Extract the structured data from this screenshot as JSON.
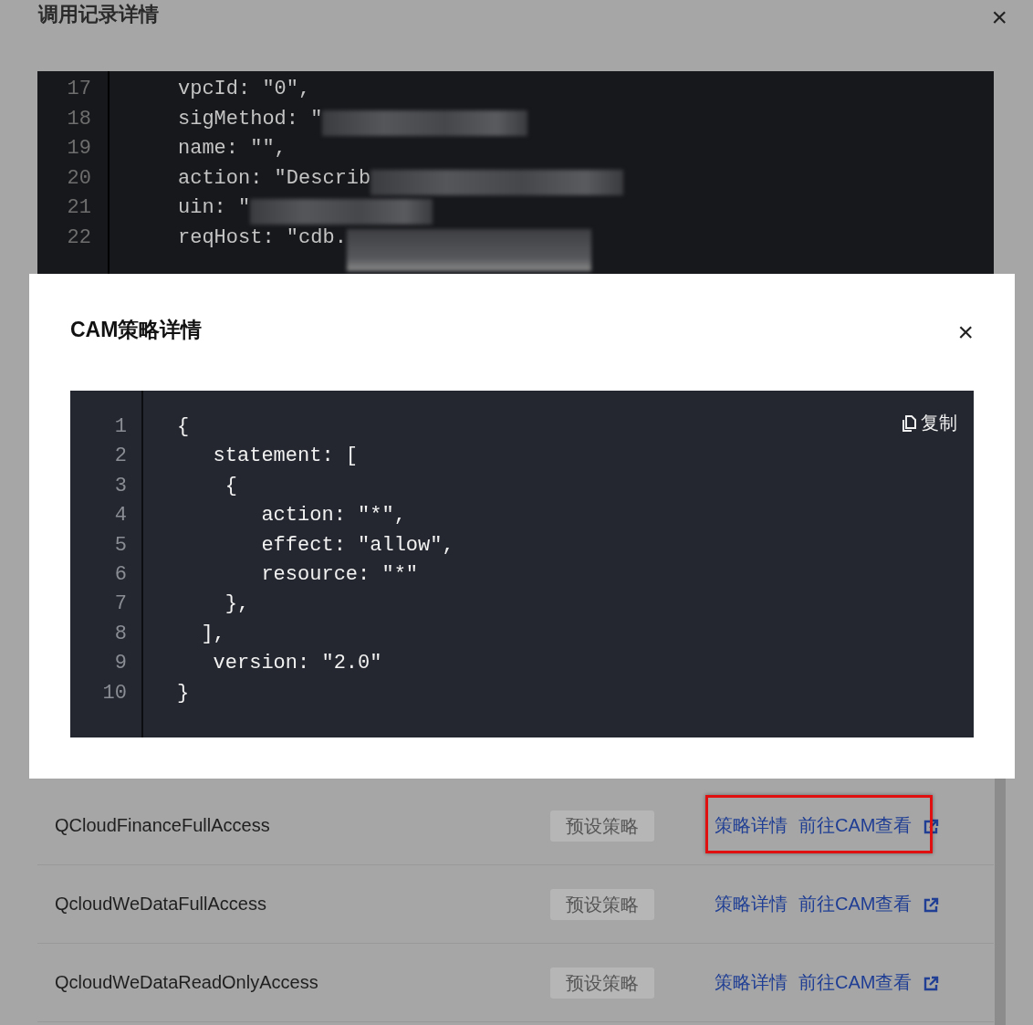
{
  "background_dialog": {
    "title": "调用记录详情",
    "close": "×",
    "code_lines": [
      {
        "number": "17",
        "text": "vpcId: \"0\",",
        "redacted": false
      },
      {
        "number": "18",
        "text": "sigMethod: \"",
        "redacted": true
      },
      {
        "number": "19",
        "text": "name: \"\",",
        "redacted": false
      },
      {
        "number": "20",
        "text": "action: \"Describ",
        "redacted": true
      },
      {
        "number": "21",
        "text": "uin: \"",
        "redacted": true
      },
      {
        "number": "22",
        "text": "reqHost: \"cdb.",
        "redacted": true
      }
    ]
  },
  "policies": [
    {
      "name": "QCloudFinanceFullAccess",
      "tag": "预设策略",
      "detail_link": "策略详情",
      "cam_link": "前往CAM查看",
      "highlighted": true
    },
    {
      "name": "QcloudWeDataFullAccess",
      "tag": "预设策略",
      "detail_link": "策略详情",
      "cam_link": "前往CAM查看",
      "highlighted": false
    },
    {
      "name": "QcloudWeDataReadOnlyAccess",
      "tag": "预设策略",
      "detail_link": "策略详情",
      "cam_link": "前往CAM查看",
      "highlighted": false
    }
  ],
  "modal": {
    "title": "CAM策略详情",
    "close": "×",
    "copy_button": "复制",
    "code_lines": [
      {
        "number": "1",
        "text": "{"
      },
      {
        "number": "2",
        "text": "   statement: ["
      },
      {
        "number": "3",
        "text": "    {"
      },
      {
        "number": "4",
        "text": "       action: \"*\","
      },
      {
        "number": "5",
        "text": "       effect: \"allow\","
      },
      {
        "number": "6",
        "text": "       resource: \"*\""
      },
      {
        "number": "7",
        "text": "    },"
      },
      {
        "number": "8",
        "text": "  ],"
      },
      {
        "number": "9",
        "text": "   version: \"2.0\""
      },
      {
        "number": "10",
        "text": "}"
      }
    ]
  }
}
